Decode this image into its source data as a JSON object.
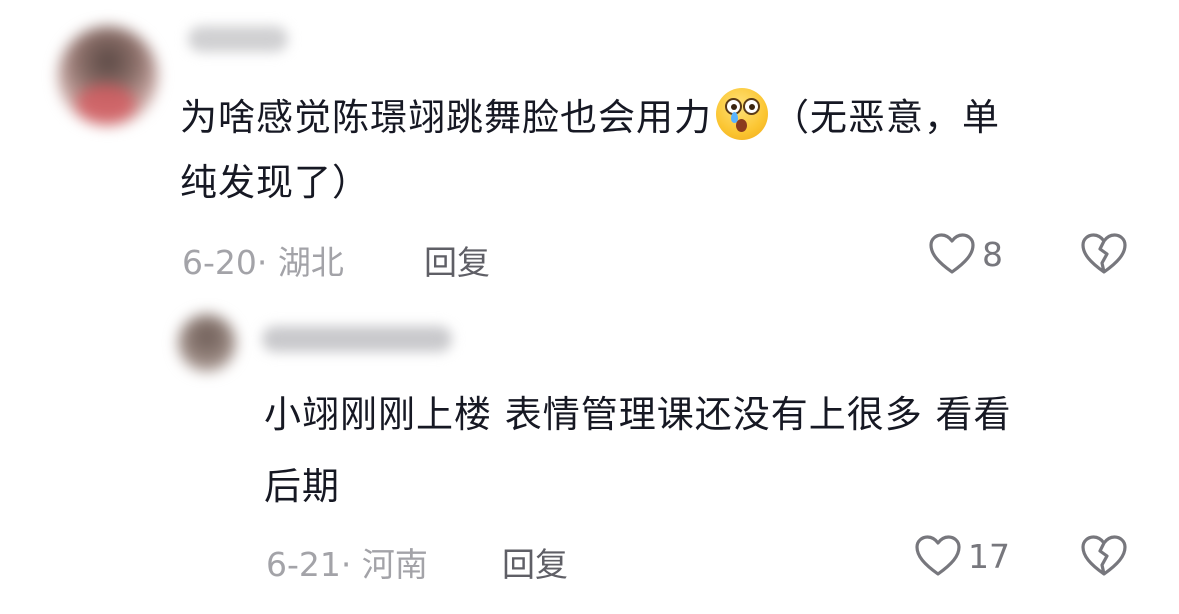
{
  "comments": [
    {
      "text_line1_before_emoji": "为啥感觉陈璟翊跳舞脸也会用力",
      "emoji": "astonished-face-with-tear",
      "text_line1_after_emoji": "（无恶意，单",
      "text_line2": "纯发现了）",
      "date_location": "6-20· 湖北",
      "reply_label": "回复",
      "like_count": "8"
    },
    {
      "text_line1": "小翊刚刚上楼 表情管理课还没有上很多 看看",
      "text_line2": "后期",
      "date_location": "6-21· 河南",
      "reply_label": "回复",
      "like_count": "17"
    }
  ],
  "icons": {
    "like": "heart-outline-icon",
    "dislike": "broken-heart-icon"
  }
}
